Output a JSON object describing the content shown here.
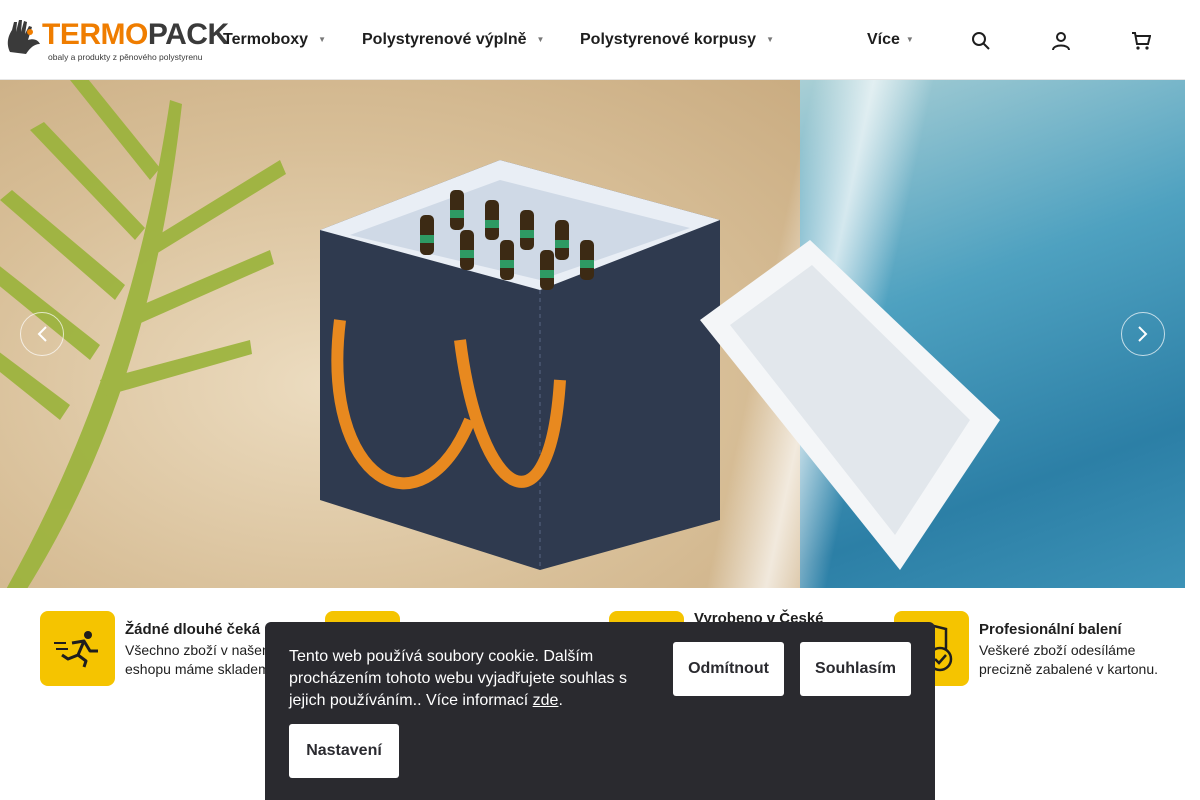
{
  "brand": {
    "word_a": "TERMO",
    "word_b": "PACK",
    "tagline": "obaly a produkty z pěnového polystyrenu"
  },
  "nav": [
    {
      "label": "Termoboxy"
    },
    {
      "label": "Polystyrenové výplně"
    },
    {
      "label": "Polystyrenové korpusy"
    },
    {
      "label": "Více"
    }
  ],
  "header_icons": [
    "search-icon",
    "user-icon",
    "cart-icon"
  ],
  "hero": {
    "prev_icon": "chevron-left-icon",
    "next_icon": "chevron-right-icon"
  },
  "benefits": [
    {
      "title": "Žádné dlouhé čeká",
      "text1": "Všechno zboží v našem",
      "text2": "eshopu máme skladem",
      "icon": "running-person-icon"
    },
    {
      "title": "",
      "text1": "",
      "text2": "",
      "icon": "truck-icon"
    },
    {
      "title": "Vyrobeno v České",
      "text1": "",
      "text2": "",
      "icon": "flag-icon"
    },
    {
      "title": "Profesionální balení",
      "text1": "Veškeré zboží odesíláme",
      "text2": "precizně zabalené v kartonu.",
      "icon": "shield-check-icon"
    }
  ],
  "cookie": {
    "text": "Tento web používá soubory cookie. Dalším procházením tohoto webu vyjadřujete souhlas s jejich používáním.. Více informací ",
    "link": "zde",
    "suffix": ".",
    "decline": "Odmítnout",
    "accept": "Souhlasím",
    "settings": "Nastavení"
  },
  "colors": {
    "accent": "#ef7d00",
    "benefit_yellow": "#f5c400",
    "cookie_bg": "#2a2a2f"
  }
}
